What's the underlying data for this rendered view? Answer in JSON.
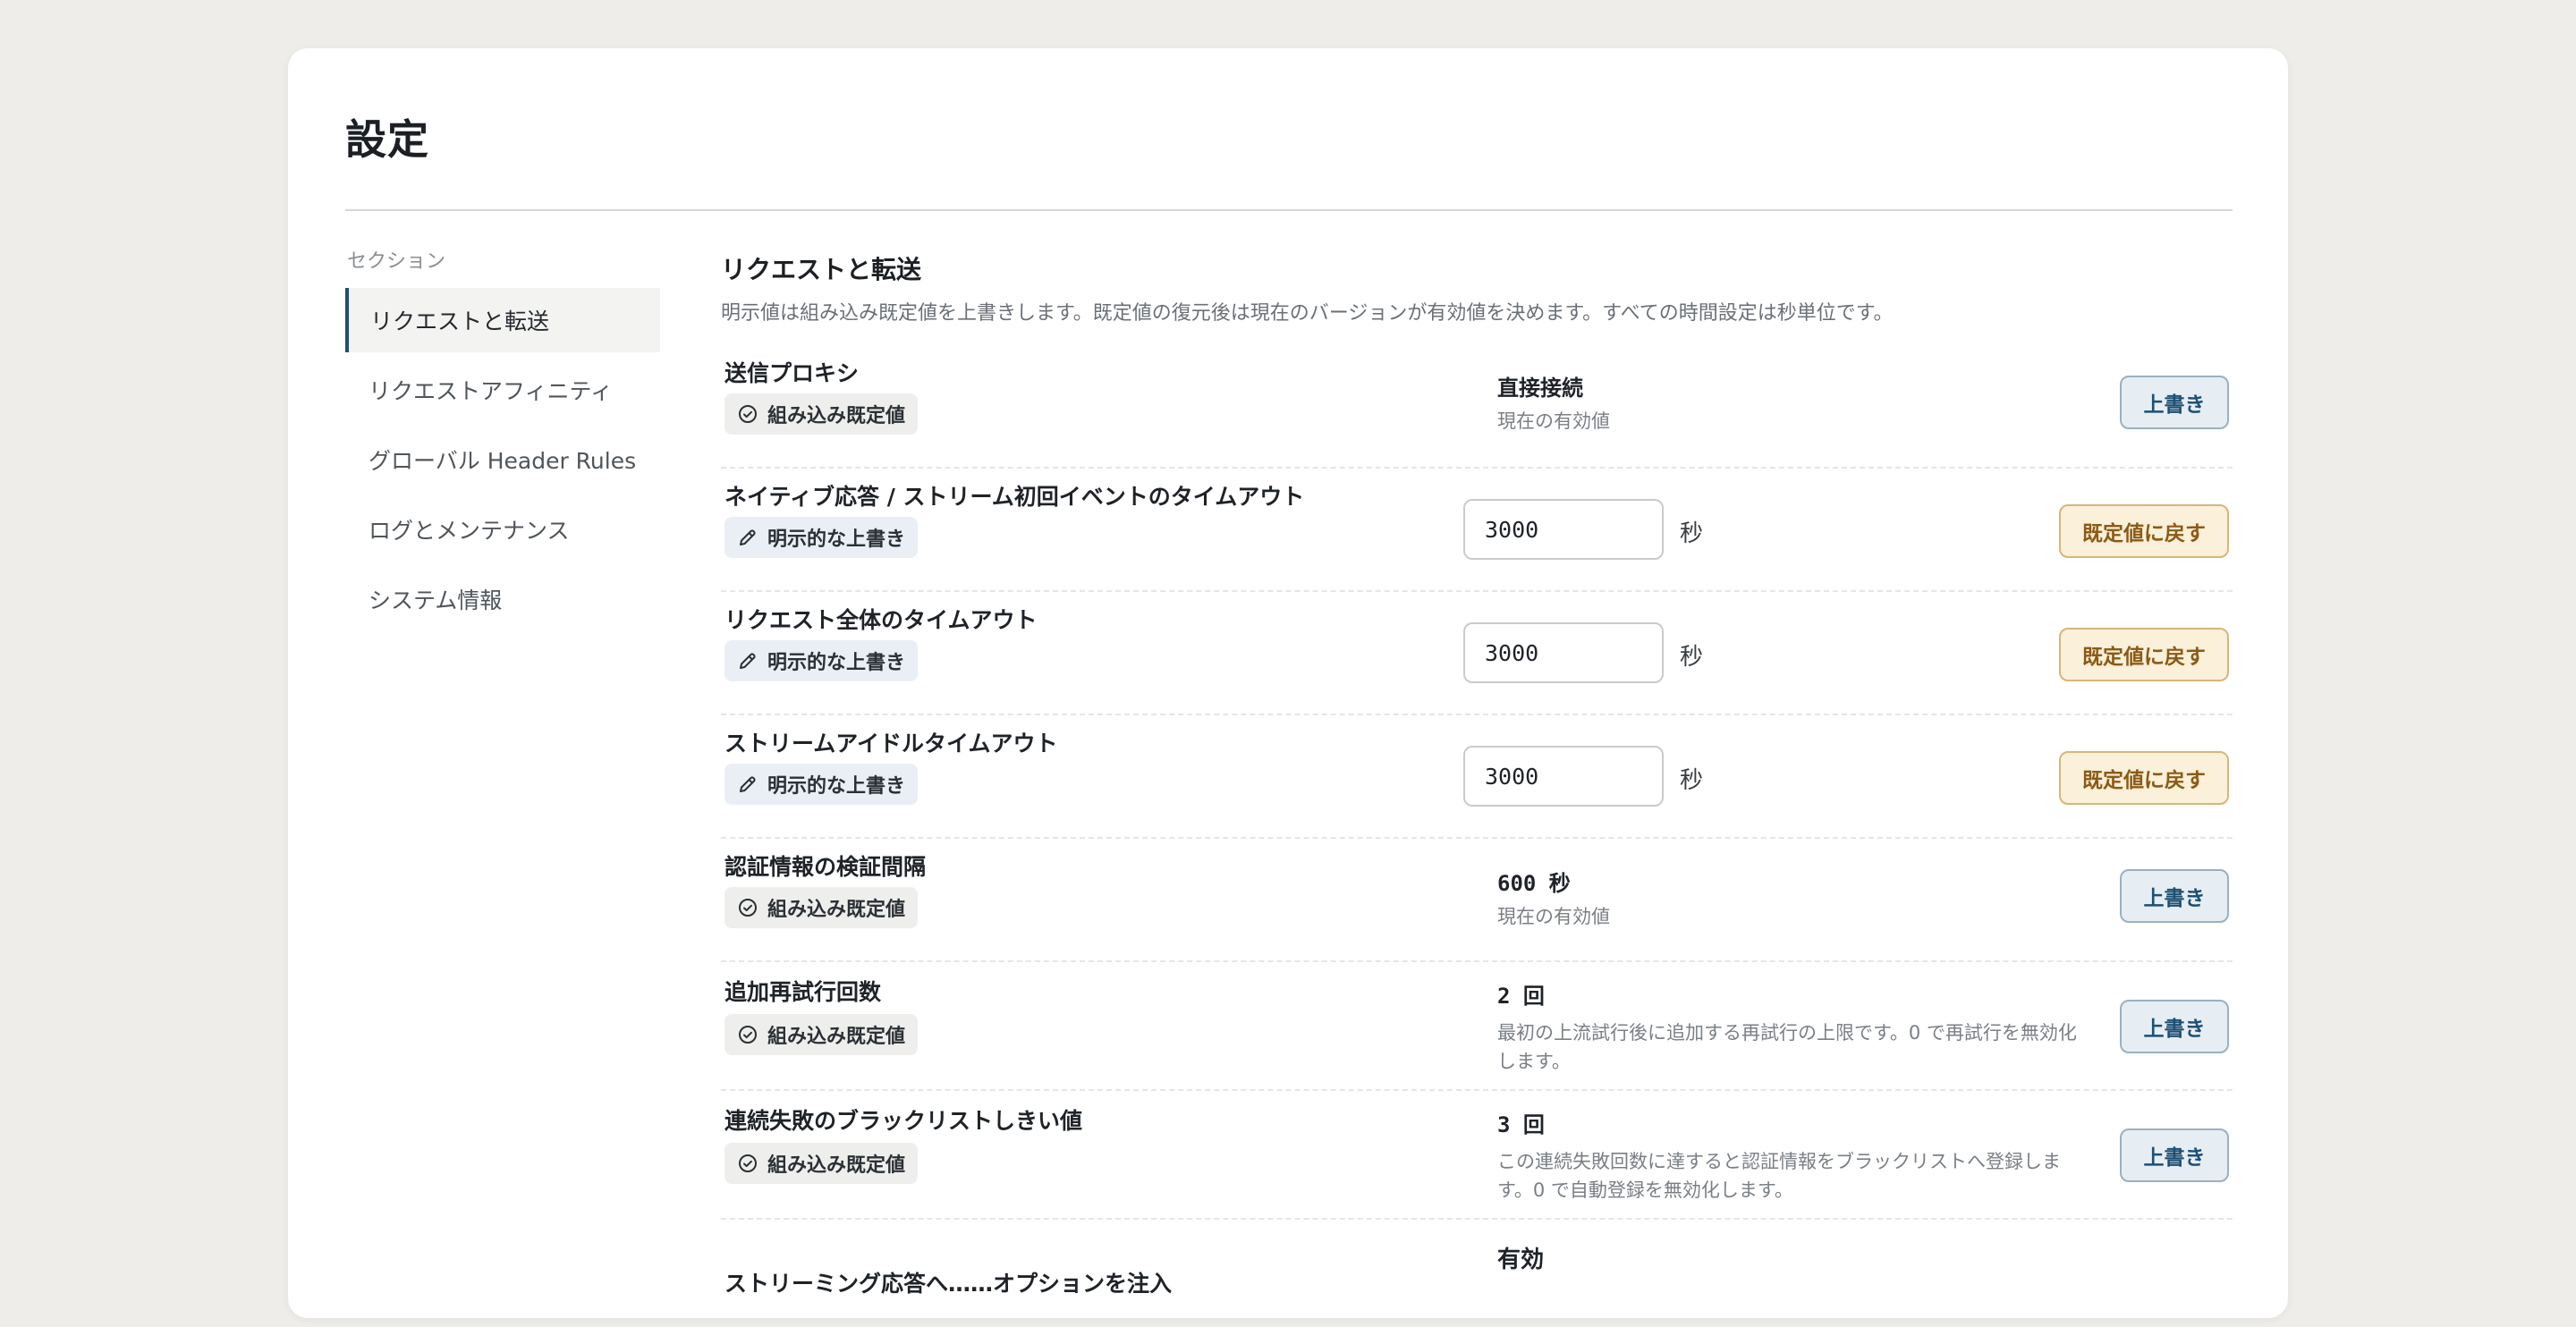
{
  "page": {
    "title": "設定"
  },
  "sidebar": {
    "heading": "セクション",
    "items": [
      {
        "label": "リクエストと転送"
      },
      {
        "label": "リクエストアフィニティ"
      },
      {
        "label": "グローバル Header Rules"
      },
      {
        "label": "ログとメンテナンス"
      },
      {
        "label": "システム情報"
      }
    ]
  },
  "section": {
    "title": "リクエストと転送",
    "description": "明示値は組み込み既定値を上書きします。既定値の復元後は現在のバージョンが有効値を決めます。すべての時間設定は秒単位です。"
  },
  "badges": {
    "builtin": "組み込み既定値",
    "explicit": "明示的な上書き"
  },
  "buttons": {
    "override": "上書き",
    "reset": "既定値に戻す"
  },
  "settings": [
    {
      "label": "送信プロキシ",
      "value": "直接接続",
      "sub": "現在の有効値"
    },
    {
      "label": "ネイティブ応答 / ストリーム初回イベントのタイムアウト",
      "input_value": "3000",
      "unit": "秒"
    },
    {
      "label": "リクエスト全体のタイムアウト",
      "input_value": "3000",
      "unit": "秒"
    },
    {
      "label": "ストリームアイドルタイムアウト",
      "input_value": "3000",
      "unit": "秒"
    },
    {
      "label": "認証情報の検証間隔",
      "value": "600 秒",
      "sub": "現在の有効値"
    },
    {
      "label": "追加再試行回数",
      "value": "2 回",
      "sub": "最初の上流試行後に追加する再試行の上限です。0 で再試行を無効化します。"
    },
    {
      "label": "連続失敗のブラックリストしきい値",
      "value": "3 回",
      "sub": "この連続失敗回数に達すると認証情報をブラックリストへ登録します。0 で自動登録を無効化します。"
    },
    {
      "label": "ストリーミング応答へ……オプションを注入",
      "value": "有効"
    }
  ],
  "colors": {
    "accent": "#1e4f73",
    "reset_bg": "#fbf0d9",
    "reset_text": "#8a5a16",
    "page_bg": "#eeede9"
  },
  "icons": {
    "builtin": "check-circle-icon",
    "explicit": "pencil-icon"
  }
}
